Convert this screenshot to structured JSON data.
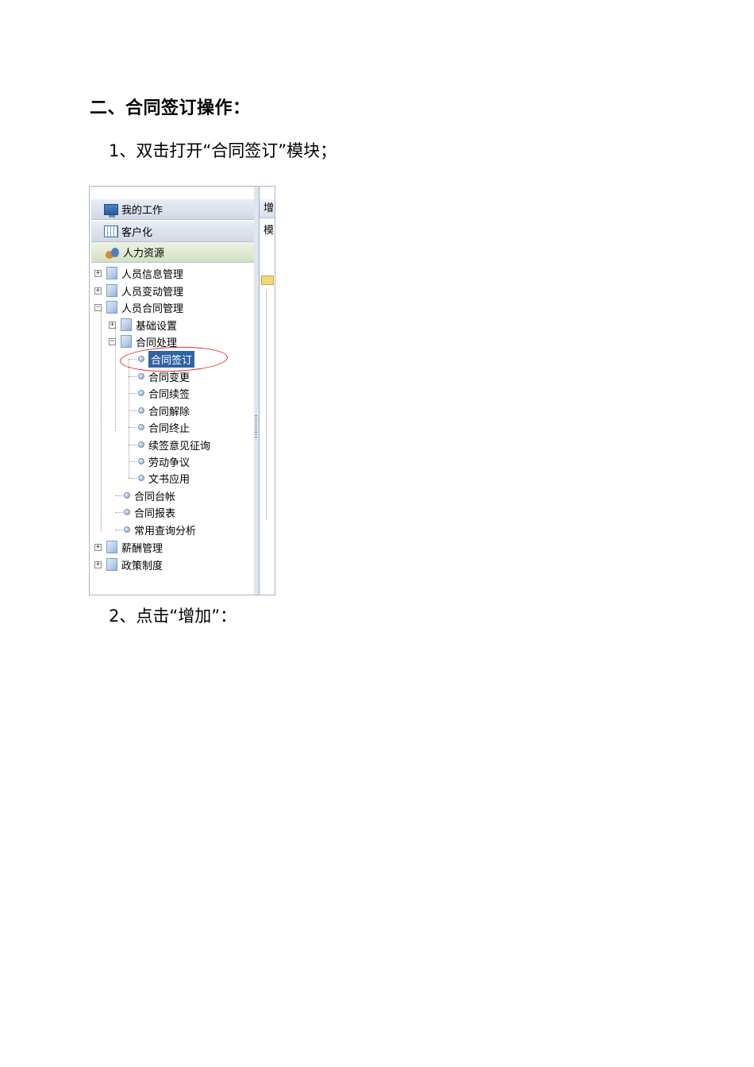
{
  "heading": "二、合同签订操作：",
  "steps": [
    "1、双击打开“合同签订”模块；",
    "2、点击“增加”："
  ],
  "screenshot": {
    "nav_headers": [
      {
        "label": "我的工作",
        "icon": "monitor-icon"
      },
      {
        "label": "客户化",
        "icon": "calendar-icon"
      },
      {
        "label": "人力资源",
        "icon": "people-icon"
      }
    ],
    "tree": {
      "top_items": [
        "人员信息管理",
        "人员变动管理",
        "人员合同管理",
        "薪酬管理",
        "政策制度"
      ],
      "contract_children": [
        "基础设置",
        "合同处理",
        "合同台帐",
        "合同报表",
        "常用查询分析"
      ],
      "processing_children": [
        "合同签订",
        "合同变更",
        "合同续签",
        "合同解除",
        "合同终止",
        "续签意见征询",
        "劳动争议",
        "文书应用"
      ],
      "selected": "合同签订"
    },
    "right_panel": {
      "toolbar_fragment": "增",
      "row_fragment": "模"
    },
    "highlight_color": "#e0312f"
  }
}
